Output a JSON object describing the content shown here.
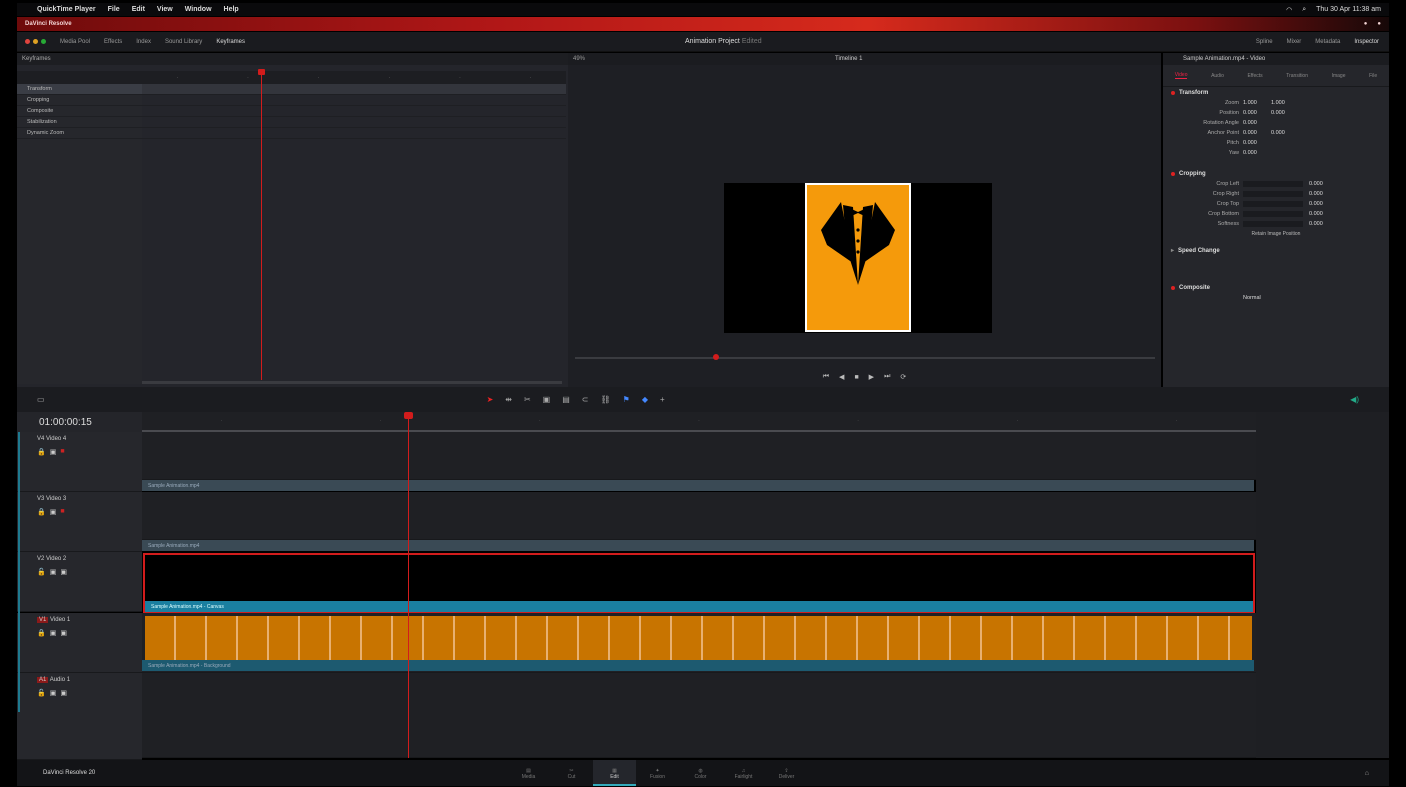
{
  "menubar": {
    "app": "QuickTime Player",
    "items": [
      "File",
      "Edit",
      "View",
      "Window",
      "Help"
    ],
    "clock": "Thu 30 Apr 11:38 am"
  },
  "app_title": "DaVinci Resolve",
  "toolbar": {
    "project_title": "Animation Project",
    "project_status": "Edited",
    "left_items": [
      "Media Pool",
      "Effects",
      "Index",
      "Sound Library",
      "Keyframes"
    ],
    "right_items": [
      "Spline",
      "Mixer",
      "Metadata",
      "Inspector"
    ]
  },
  "fusion": {
    "header": "Keyframes",
    "tracks": [
      "Transform",
      "Cropping",
      "Composite",
      "Stabilization",
      "Dynamic Zoom"
    ]
  },
  "viewer": {
    "zoom": "49%",
    "timeline_name": "Timeline 1",
    "transport": [
      "⏮",
      "◀",
      "■",
      "▶",
      "⏭",
      "⟳"
    ],
    "card_color": "#f59a0b"
  },
  "inspector": {
    "clip_title": "Sample Animation.mp4 - Video",
    "tabs": [
      "Video",
      "Audio",
      "Effects",
      "Transition",
      "Image",
      "File"
    ],
    "sections": {
      "transform": "Transform",
      "cropping": "Cropping",
      "speed": "Speed Change",
      "composite": "Composite"
    },
    "transform_rows": [
      {
        "label": "Zoom",
        "x": "1.000",
        "y": "1.000"
      },
      {
        "label": "Position",
        "x": "0.000",
        "y": "0.000"
      },
      {
        "label": "Rotation Angle",
        "x": "0.000",
        "y": ""
      },
      {
        "label": "Anchor Point",
        "x": "0.000",
        "y": "0.000"
      },
      {
        "label": "Pitch",
        "x": "0.000",
        "y": ""
      },
      {
        "label": "Yaw",
        "x": "0.000",
        "y": ""
      }
    ],
    "cropping_rows": [
      {
        "label": "Crop Left",
        "value": "0.000"
      },
      {
        "label": "Crop Right",
        "value": "0.000"
      },
      {
        "label": "Crop Top",
        "value": "0.000"
      },
      {
        "label": "Crop Bottom",
        "value": "0.000"
      },
      {
        "label": "Softness",
        "value": "0.000"
      }
    ],
    "retain_label": "Retain Image Position",
    "composite_mode": "Normal"
  },
  "timeline": {
    "timecode": "01:00:00:15",
    "tracks": [
      {
        "id": "V4",
        "name": "Video 4",
        "clip": "Sample Animation.mp4"
      },
      {
        "id": "V3",
        "name": "Video 3",
        "clip": "Sample Animation.mp4"
      },
      {
        "id": "V2",
        "name": "Video 2",
        "clip": "Sample Animation.mp4 - Canvas"
      },
      {
        "id": "V1",
        "name": "Video 1",
        "clip": "Sample Animation.mp4 - Background"
      },
      {
        "id": "A1",
        "name": "Audio 1",
        "clip": ""
      }
    ]
  },
  "bottom": {
    "brand": "DaVinci Resolve 20",
    "pages": [
      "Media",
      "Cut",
      "Edit",
      "Fusion",
      "Color",
      "Fairlight",
      "Deliver"
    ],
    "active_page": "Edit"
  }
}
